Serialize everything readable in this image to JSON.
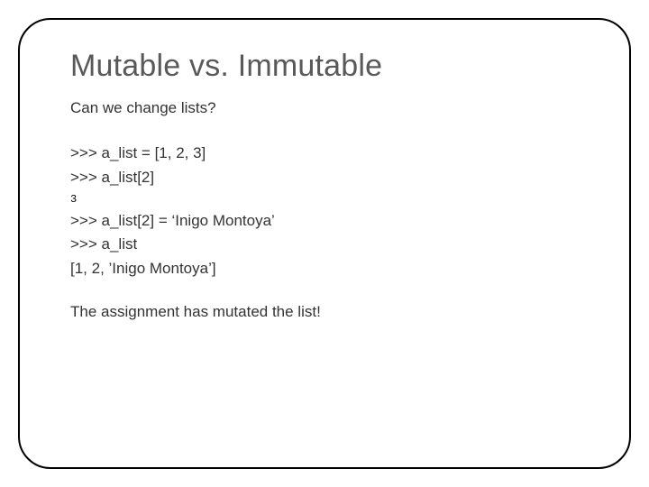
{
  "title": "Mutable vs. Immutable",
  "subtitle": "Can we change lists?",
  "code": {
    "line1": ">>> a_list = [1, 2, 3]",
    "line2": ">>> a_list[2]",
    "out1": "3",
    "line3": ">>> a_list[2] = ‘Inigo Montoya’",
    "line4": ">>> a_list",
    "out2": "[1, 2, ’Inigo Montoya’]"
  },
  "conclusion": "The assignment has mutated the list!"
}
